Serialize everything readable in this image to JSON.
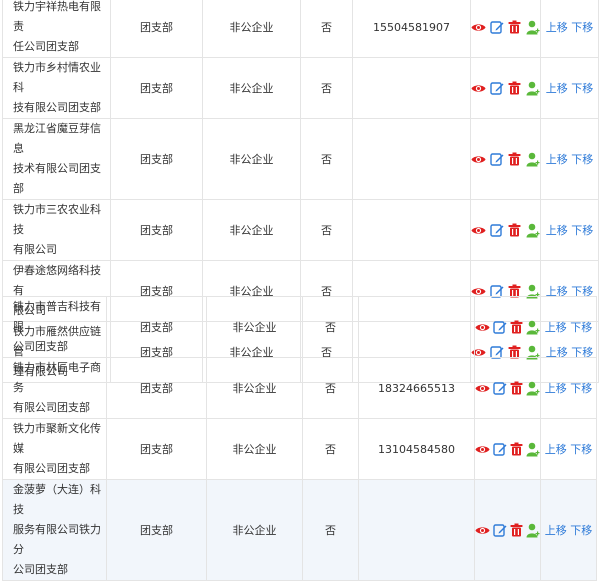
{
  "colors": {
    "accent": "#2f7bd8",
    "view": "#e02020",
    "edit": "#2f7bd8",
    "delete": "#e02020",
    "member": "#5ab83a",
    "border": "#e4e4e4",
    "highlight_row": "#f2f6fb"
  },
  "icons": {
    "view": "eye-icon",
    "edit": "edit-icon",
    "delete": "trash-icon",
    "member": "member-icon"
  },
  "move_up": "上移",
  "move_down": "下移",
  "rows": [
    {
      "name_l1": "铁力宇祥热电有限责",
      "name_l2": "任公司团支部",
      "type": "团支部",
      "category": "非公企业",
      "flag": "否",
      "phone": "15504581907"
    },
    {
      "name_l1": "铁力市乡村情农业科",
      "name_l2": "技有限公司团支部",
      "type": "团支部",
      "category": "非公企业",
      "flag": "否",
      "phone": ""
    },
    {
      "name_l1": "黑龙江省魔豆芽信息",
      "name_l2": "技术有限公司团支部",
      "type": "团支部",
      "category": "非公企业",
      "flag": "否",
      "phone": ""
    },
    {
      "name_l1": "铁力市三农农业科技",
      "name_l2": "有限公司",
      "type": "团支部",
      "category": "非公企业",
      "flag": "否",
      "phone": ""
    },
    {
      "name_l1": "伊春途悠网络科技有",
      "name_l2": "限公司",
      "type": "团支部",
      "category": "非公企业",
      "flag": "否",
      "phone": ""
    },
    {
      "name_l1": "铁力市雁然供应链管",
      "name_l2": "理有限公司",
      "type": "团支部",
      "category": "非公企业",
      "flag": "否",
      "phone": ""
    },
    {
      "name_l1": "铁力市普吉科技有限",
      "name_l2": "公司团支部",
      "type": "团支部",
      "category": "非公企业",
      "flag": "否",
      "phone": ""
    },
    {
      "name_l1": "铁力市林匠电子商务",
      "name_l2": "有限公司团支部",
      "type": "团支部",
      "category": "非公企业",
      "flag": "否",
      "phone": "18324665513"
    },
    {
      "name_l1": "铁力市聚新文化传媒",
      "name_l2": "有限公司团支部",
      "type": "团支部",
      "category": "非公企业",
      "flag": "否",
      "phone": "13104584580"
    },
    {
      "name_l1": "金菠萝（大连）科技",
      "name_l2": "服务有限公司铁力分",
      "name_l3": "公司团支部",
      "type": "团支部",
      "category": "非公企业",
      "flag": "否",
      "phone": ""
    }
  ]
}
